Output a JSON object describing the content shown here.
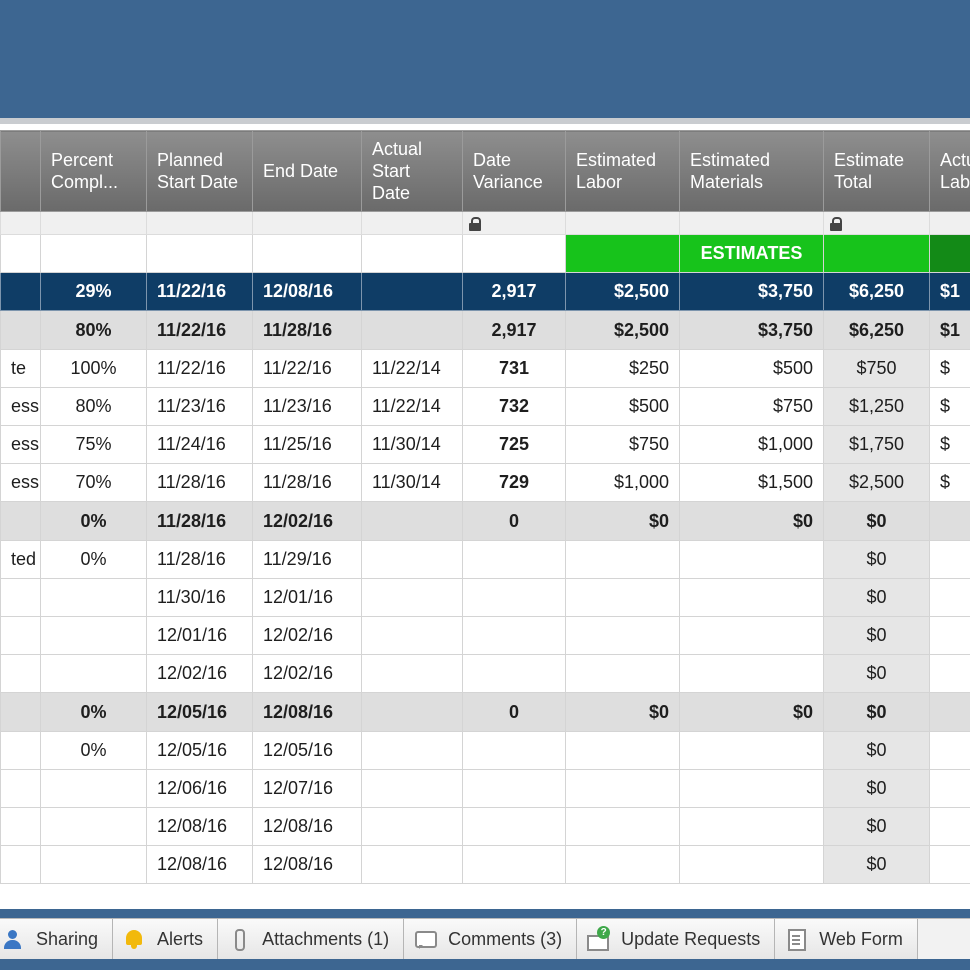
{
  "columns": [
    {
      "label": ""
    },
    {
      "label": "Percent Compl..."
    },
    {
      "label": "Planned Start Date"
    },
    {
      "label": "End Date"
    },
    {
      "label": "Actual Start Date"
    },
    {
      "label": "Date Variance"
    },
    {
      "label": "Estimated Labor"
    },
    {
      "label": "Estimated Materials"
    },
    {
      "label": "Estimate Total"
    },
    {
      "label": "Actual Labor"
    }
  ],
  "estimates_label": "ESTIMATES",
  "rows": [
    {
      "type": "navy",
      "cells": [
        "",
        "29%",
        "11/22/16",
        "12/08/16",
        "",
        "2,917",
        "$2,500",
        "$3,750",
        "$6,250",
        "$1"
      ]
    },
    {
      "type": "grey",
      "cells": [
        "",
        "80%",
        "11/22/16",
        "11/28/16",
        "",
        "2,917",
        "$2,500",
        "$3,750",
        "$6,250",
        "$1"
      ]
    },
    {
      "type": "row",
      "cells": [
        "te",
        "100%",
        "11/22/16",
        "11/22/16",
        "11/22/14",
        "731",
        "$250",
        "$500",
        "$750",
        "$"
      ]
    },
    {
      "type": "row",
      "cells": [
        "ess",
        "80%",
        "11/23/16",
        "11/23/16",
        "11/22/14",
        "732",
        "$500",
        "$750",
        "$1,250",
        "$"
      ]
    },
    {
      "type": "row",
      "cells": [
        "ess",
        "75%",
        "11/24/16",
        "11/25/16",
        "11/30/14",
        "725",
        "$750",
        "$1,000",
        "$1,750",
        "$"
      ]
    },
    {
      "type": "row",
      "cells": [
        "ess",
        "70%",
        "11/28/16",
        "11/28/16",
        "11/30/14",
        "729",
        "$1,000",
        "$1,500",
        "$2,500",
        "$"
      ]
    },
    {
      "type": "grey",
      "cells": [
        "",
        "0%",
        "11/28/16",
        "12/02/16",
        "",
        "0",
        "$0",
        "$0",
        "$0",
        ""
      ]
    },
    {
      "type": "row",
      "cells": [
        "ted",
        "0%",
        "11/28/16",
        "11/29/16",
        "",
        "",
        "",
        "",
        "$0",
        ""
      ]
    },
    {
      "type": "row",
      "cells": [
        "",
        "",
        "11/30/16",
        "12/01/16",
        "",
        "",
        "",
        "",
        "$0",
        ""
      ]
    },
    {
      "type": "row",
      "cells": [
        "",
        "",
        "12/01/16",
        "12/02/16",
        "",
        "",
        "",
        "",
        "$0",
        ""
      ]
    },
    {
      "type": "row",
      "cells": [
        "",
        "",
        "12/02/16",
        "12/02/16",
        "",
        "",
        "",
        "",
        "$0",
        ""
      ]
    },
    {
      "type": "grey",
      "cells": [
        "",
        "0%",
        "12/05/16",
        "12/08/16",
        "",
        "0",
        "$0",
        "$0",
        "$0",
        ""
      ]
    },
    {
      "type": "row",
      "cells": [
        "",
        "0%",
        "12/05/16",
        "12/05/16",
        "",
        "",
        "",
        "",
        "$0",
        ""
      ]
    },
    {
      "type": "row",
      "cells": [
        "",
        "",
        "12/06/16",
        "12/07/16",
        "",
        "",
        "",
        "",
        "$0",
        ""
      ]
    },
    {
      "type": "row",
      "cells": [
        "",
        "",
        "12/08/16",
        "12/08/16",
        "",
        "",
        "",
        "",
        "$0",
        ""
      ]
    },
    {
      "type": "row",
      "cells": [
        "",
        "",
        "12/08/16",
        "12/08/16",
        "",
        "",
        "",
        "",
        "$0",
        ""
      ]
    }
  ],
  "tabs": [
    {
      "label": "Sharing",
      "icon": "person-icon"
    },
    {
      "label": "Alerts",
      "icon": "bell-icon"
    },
    {
      "label": "Attachments (1)",
      "icon": "paperclip-icon"
    },
    {
      "label": "Comments (3)",
      "icon": "comment-icon"
    },
    {
      "label": "Update Requests",
      "icon": "update-request-icon"
    },
    {
      "label": "Web Form",
      "icon": "form-icon"
    }
  ]
}
